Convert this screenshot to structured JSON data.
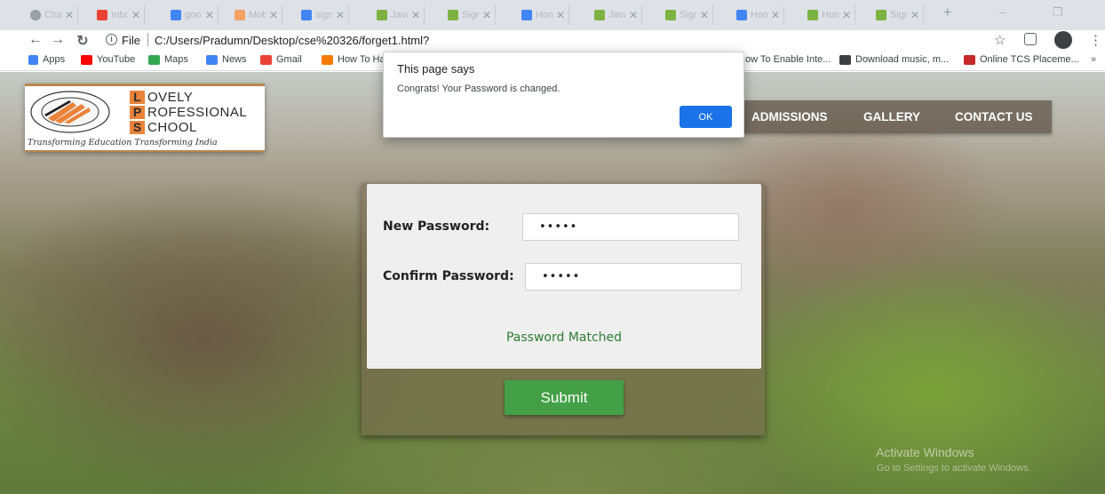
{
  "browser": {
    "tabs": [
      {
        "label": "Cha",
        "color": "#9aa0a6"
      },
      {
        "label": "Inbo",
        "color": "#ea4335"
      },
      {
        "label": "goo",
        "color": "#4285f4"
      },
      {
        "label": "Mob",
        "color": "#f4a261"
      },
      {
        "label": "sign",
        "color": "#4285f4"
      },
      {
        "label": "Java",
        "color": "#7cb342"
      },
      {
        "label": "Sign",
        "color": "#7cb342"
      },
      {
        "label": "Hom",
        "color": "#4285f4"
      },
      {
        "label": "Java",
        "color": "#7cb342"
      },
      {
        "label": "Sign",
        "color": "#7cb342"
      },
      {
        "label": "Hom",
        "color": "#4285f4"
      },
      {
        "label": "Hom",
        "color": "#7cb342"
      },
      {
        "label": "Sign",
        "color": "#7cb342"
      }
    ],
    "new_tab": "+",
    "window_minimize": "–",
    "window_restore": "❐",
    "address": {
      "scheme": "File",
      "url": "C:/Users/Pradumn/Desktop/cse%20326/forget1.html?"
    },
    "bookmarks": [
      {
        "label": "Apps",
        "color": "#4285f4"
      },
      {
        "label": "YouTube",
        "color": "#ff0000"
      },
      {
        "label": "Maps",
        "color": "#34a853"
      },
      {
        "label": "News",
        "color": "#4285f4"
      },
      {
        "label": "Gmail",
        "color": "#ea4335"
      },
      {
        "label": "How To Ha",
        "color": "#f57c00"
      },
      {
        "label": "ow To Enable Inte...",
        "color": "#9aa0a6"
      },
      {
        "label": "Download music, m...",
        "color": "#3c4043"
      },
      {
        "label": "Online TCS Placeme...",
        "color": "#c62828"
      }
    ],
    "bookmarks_more": "»"
  },
  "site": {
    "logo": {
      "letters": [
        "L",
        "P",
        "S"
      ],
      "words": [
        "OVELY",
        "ROFESSIONAL",
        "CHOOL"
      ],
      "tagline": "Transforming Education Transforming India"
    },
    "nav": [
      "ADMISSIONS",
      "GALLERY",
      "CONTACT US"
    ]
  },
  "form": {
    "new_password_label": "New Password:",
    "new_password_value": "•••••",
    "confirm_password_label": "Confirm Password:",
    "confirm_password_value": "•••••",
    "match_message": "Password Matched",
    "submit_label": "Submit"
  },
  "alert": {
    "title": "This page says",
    "message": "Congrats! Your Password is changed.",
    "ok_label": "OK"
  },
  "watermark": {
    "title": "Activate Windows",
    "subtitle": "Go to Settings to activate Windows."
  },
  "colors": {
    "accent_button": "#1a73e8",
    "submit_green": "#43a047",
    "success_text": "#2e7d32",
    "logo_orange": "#e9833a"
  }
}
